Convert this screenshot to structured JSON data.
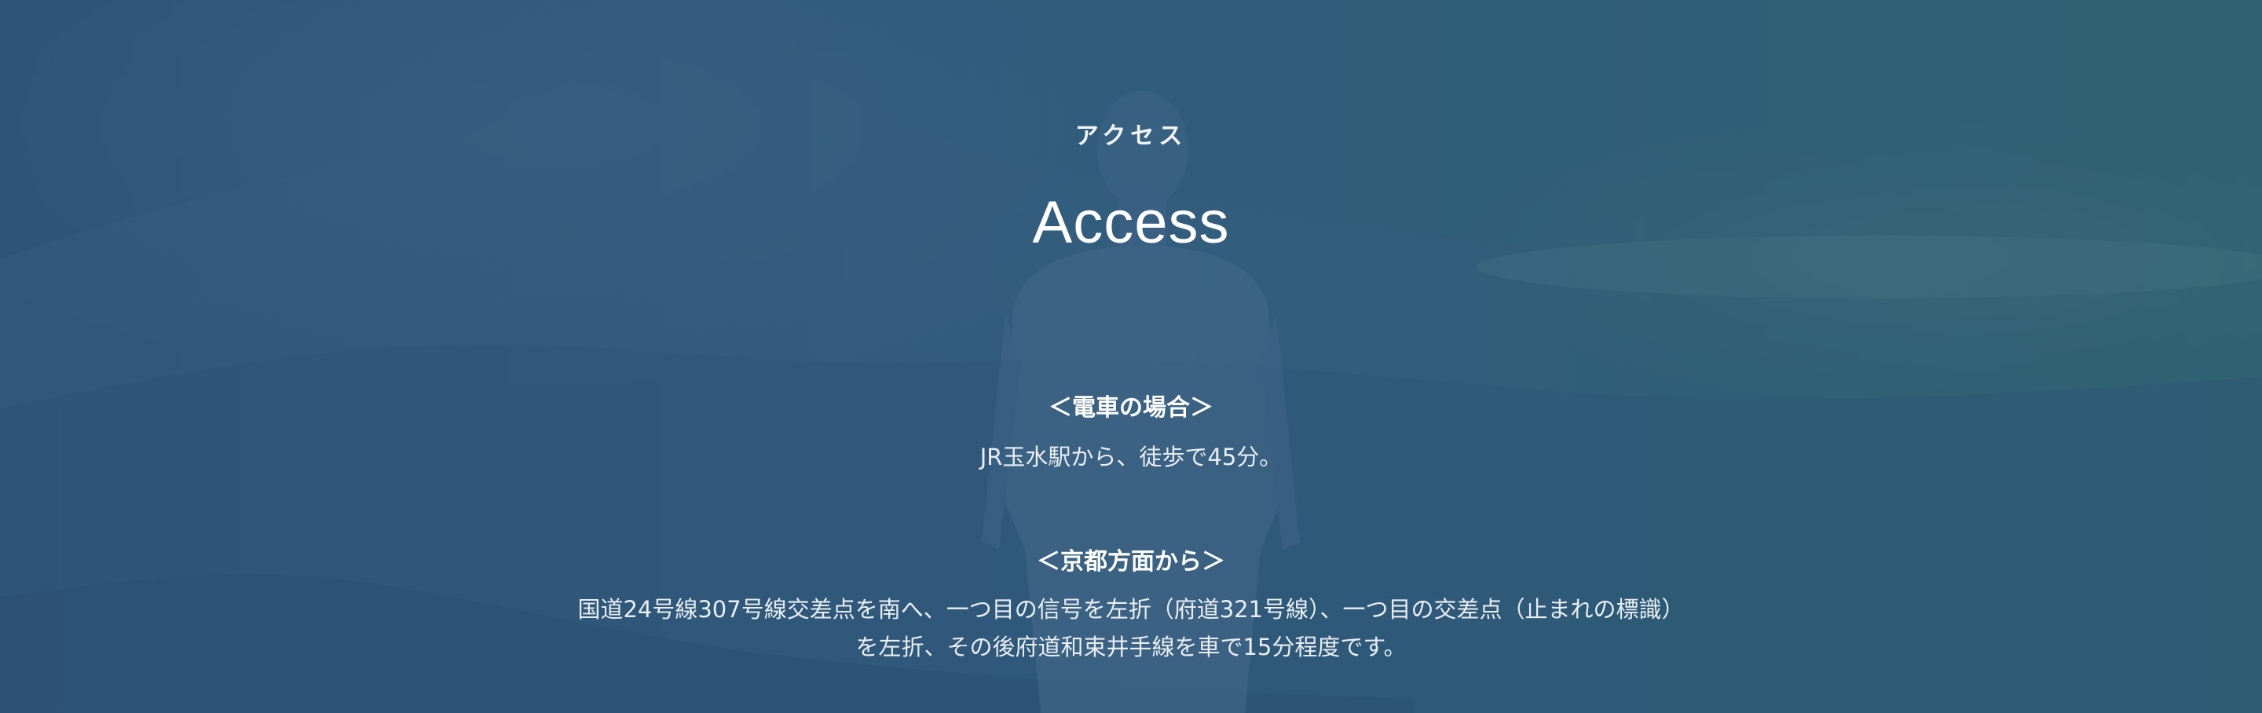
{
  "hero": {
    "kicker": "アクセス",
    "title": "Access"
  },
  "train": {
    "heading": "＜電車の場合＞",
    "text": "JR玉水駅から、徒歩で45分。"
  },
  "kyoto": {
    "heading": "＜京都方面から＞",
    "line1": "国道24号線307号線交差点を南へ、一つ目の信号を左折（府道321号線）、一つ目の交差点（止まれの標識）",
    "line2": "を左折、その後府道和束井手線を車で15分程度です。"
  },
  "colors": {
    "overlay_dark": "#2d5478",
    "overlay_teal": "#2f6272",
    "text": "#ffffff"
  }
}
